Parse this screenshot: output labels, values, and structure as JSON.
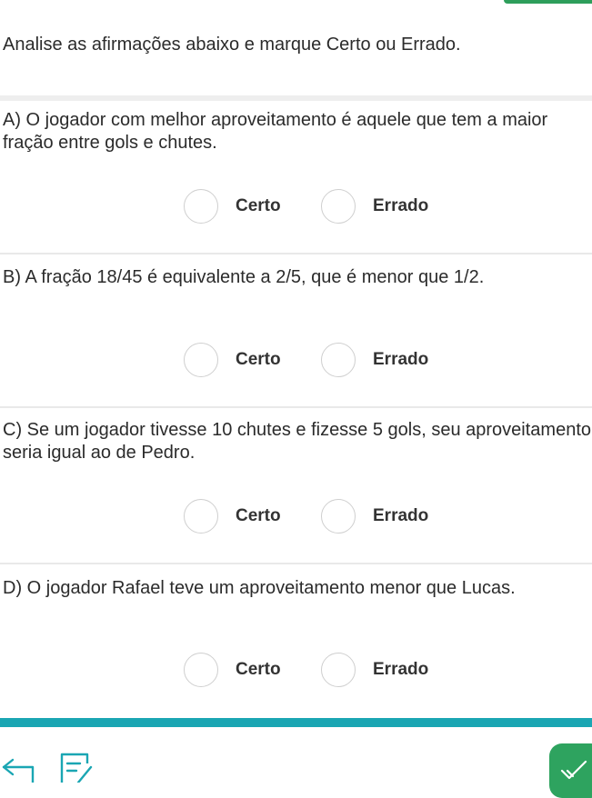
{
  "instruction": "Analise as afirmações abaixo e marque Certo ou Errado.",
  "questions": [
    {
      "text": "A) O jogador com melhor aproveitamento é aquele que tem a maior fração entre gols e chutes.",
      "option_certo": "Certo",
      "option_errado": "Errado"
    },
    {
      "text": "B) A fração 18/45 é equivalente a 2/5, que é menor que 1/2.",
      "option_certo": "Certo",
      "option_errado": "Errado"
    },
    {
      "text": "C) Se um jogador tivesse 10 chutes e fizesse 5 gols, seu aproveitamento seria igual ao de Pedro.",
      "option_certo": "Certo",
      "option_errado": "Errado"
    },
    {
      "text": "D) O jogador Rafael teve um aproveitamento menor que Lucas.",
      "option_certo": "Certo",
      "option_errado": "Errado"
    }
  ],
  "icons": {
    "back": "back-arrow-icon",
    "notes": "notes-edit-icon",
    "confirm": "checkmark-icon"
  },
  "colors": {
    "accent_teal": "#1aa6b3",
    "accent_green": "#2e9e5b"
  }
}
